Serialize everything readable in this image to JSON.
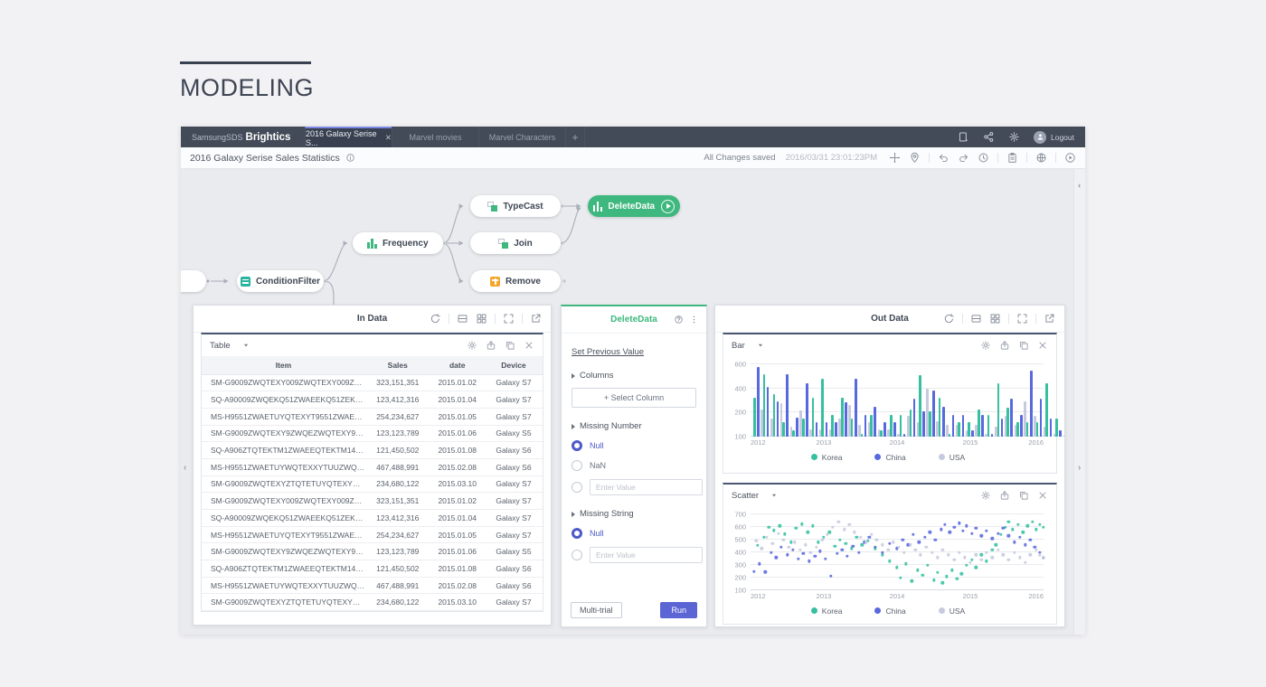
{
  "page": {
    "heading": "MODELING"
  },
  "app": {
    "logo": {
      "brand_light": "SamsungSDS",
      "brand_bold": "Brightics"
    },
    "tabs": [
      {
        "label": "2016 Galaxy Serise S...",
        "active": true,
        "close_label": "✕"
      },
      {
        "label": "Marvel movies",
        "active": false
      },
      {
        "label": "Marvel Characters",
        "active": false
      }
    ],
    "new_tab_label": "+",
    "logout_label": "Logout",
    "toolbar": {
      "title": "2016 Galaxy Serise Sales Statistics",
      "status": "All Changes saved",
      "timestamp": "2016/03/31 23:01:23PM"
    }
  },
  "icons": {
    "gear-icon": "⚙",
    "close-icon": "✕",
    "info-icon": "ⓘ",
    "question-icon": "?",
    "undo-icon": "↶",
    "redo-icon": "↷",
    "clock-icon": "◷",
    "globe-icon": "🌐",
    "play-icon": "▶",
    "pin-icon": "📍",
    "move-icon": "✥",
    "plus-icon": "+",
    "chevron-left-icon": "‹",
    "chevron-right-icon": "›",
    "caret-down-icon": "▾"
  },
  "flow": {
    "nodes": [
      {
        "label": "ConditionFilter"
      },
      {
        "label": "Frequency"
      },
      {
        "label": "TypeCast"
      },
      {
        "label": "Join"
      },
      {
        "label": "Remove"
      },
      {
        "label": "DeleteData"
      }
    ]
  },
  "in_data": {
    "title": "In Data",
    "view_selector": "Table",
    "table": {
      "headers": [
        "Item",
        "Sales",
        "date",
        "Device"
      ],
      "rows": [
        [
          "SM-G9009ZWQTEXY009ZWQTEXY009ZWQSM-G9...",
          "323,151,351",
          "2015.01.02",
          "Galaxy S7"
        ],
        [
          "SQ-A90009ZWQEKQ51ZWAEEKQ51ZEKQ51SQ-A9...",
          "123,412,316",
          "2015.01.04",
          "Galaxy S7"
        ],
        [
          "MS-H9551ZWAETUYQTEXYT9551ZWAETU-H9551...",
          "254,234,627",
          "2015.01.05",
          "Galaxy S7"
        ],
        [
          "SM-G9009ZWQTEXY9ZWQEZWQTEXY9TQ-G9009...",
          "123,123,789",
          "2015.01.06",
          "Galaxy S5"
        ],
        [
          "SQ-A906ZTQTEKTM1ZWAEEQTEKTM144A906ZTQ...",
          "121,450,502",
          "2015.01.08",
          "Galaxy S6"
        ],
        [
          "MS-H9551ZWAETUYWQTEXXYTUUZWQTTMS-H9...",
          "467,488,991",
          "2015.02.08",
          "Galaxy S6"
        ],
        [
          "SM-G9009ZWQTEXYZTQTETUYQTEXYQTESM-G9...",
          "234,680,122",
          "2015.03.10",
          "Galaxy S7"
        ],
        [
          "SM-G9009ZWQTEXY009ZWQTEXY009ZWQSM-G9...",
          "323,151,351",
          "2015.01.02",
          "Galaxy S7"
        ],
        [
          "SQ-A90009ZWQEKQ51ZWAEEKQ51ZEKQ51SQ-A9...",
          "123,412,316",
          "2015.01.04",
          "Galaxy S7"
        ],
        [
          "MS-H9551ZWAETUYQTEXYT9551ZWAETUMS-H95...",
          "254,234,627",
          "2015.01.05",
          "Galaxy S7"
        ],
        [
          "SM-G9009ZWQTEXY9ZWQEZWQTEXY9TQSM-G9...",
          "123,123,789",
          "2015.01.06",
          "Galaxy S5"
        ],
        [
          "SQ-A906ZTQTEKTM1ZWAEEQTEKTM144AA906ZT...",
          "121,450,502",
          "2015.01.08",
          "Galaxy S6"
        ],
        [
          "MS-H9551ZWAETUYWQTEXXYTUUZWQTTA906ZT...",
          "467,488,991",
          "2015.02.08",
          "Galaxy S6"
        ],
        [
          "SM-G9009ZWQTEXYZTQTETUYQTEXYQTEWQTE...",
          "234,680,122",
          "2015.03.10",
          "Galaxy S7"
        ]
      ]
    }
  },
  "delete_data": {
    "title": "DeleteData",
    "set_previous_value": "Set Previous Value",
    "columns_label": "Columns",
    "select_column_button": "+ Select Column",
    "missing_number_label": "Missing Number",
    "number_options": [
      {
        "label": "Null",
        "selected": true
      },
      {
        "label": "NaN",
        "selected": false
      },
      {
        "placeholder": "Enter Value",
        "selected": false
      }
    ],
    "missing_string_label": "Missing String",
    "string_options": [
      {
        "label": "Null",
        "selected": true
      },
      {
        "placeholder": "Enter Value",
        "selected": false
      }
    ],
    "multi_trial_button": "Multi-trial",
    "run_button": "Run"
  },
  "out_data": {
    "title": "Out Data",
    "bar_view_selector": "Bar",
    "scatter_view_selector": "Scatter"
  },
  "chart_data": [
    {
      "type": "bar",
      "title": "Out Data — Bar",
      "x_axis_labels": [
        "2012",
        "2013",
        "2014",
        "2015",
        "2016"
      ],
      "y_ticks": [
        100,
        200,
        400,
        600
      ],
      "legend": [
        "Korea",
        "China",
        "USA"
      ],
      "colors": {
        "Korea": "#36c0a0",
        "China": "#5868de",
        "USA": "#c6cade"
      },
      "series": [
        {
          "name": "Korea",
          "values": [
            320,
            515,
            350,
            160,
            125,
            175,
            320,
            480,
            190,
            320,
            175,
            110,
            190,
            125,
            190,
            190,
            225,
            510,
            210,
            320,
            110,
            160,
            160,
            225,
            190,
            440,
            240,
            160,
            160,
            160,
            445,
            175
          ]
        },
        {
          "name": "China",
          "values": [
            575,
            415,
            290,
            515,
            180,
            445,
            160,
            160,
            160,
            285,
            480,
            190,
            250,
            160,
            160,
            110,
            315,
            210,
            385,
            250,
            190,
            190,
            125,
            190,
            110,
            175,
            315,
            190,
            545,
            315,
            175,
            125
          ]
        },
        {
          "name": "USA",
          "values": [
            225,
            175,
            280,
            140,
            220,
            130,
            130,
            130,
            175,
            260,
            150,
            160,
            130,
            130,
            110,
            185,
            160,
            400,
            165,
            150,
            150,
            125,
            150,
            110,
            140,
            185,
            150,
            290,
            185,
            140,
            110,
            105
          ]
        }
      ]
    },
    {
      "type": "scatter",
      "title": "Out Data — Scatter",
      "x_axis_labels": [
        "2012",
        "2013",
        "2014",
        "2015",
        "2016"
      ],
      "x_range": [
        2012,
        2016
      ],
      "y_ticks": [
        100,
        200,
        300,
        400,
        500,
        600,
        700
      ],
      "legend": [
        "Korea",
        "China",
        "USA"
      ],
      "colors": {
        "Korea": "#36c0a0",
        "China": "#5868de",
        "USA": "#c6cade"
      },
      "series": [
        {
          "name": "Korea",
          "points": [
            [
              2012.1,
              455
            ],
            [
              2012.18,
              520
            ],
            [
              2012.25,
              600
            ],
            [
              2012.32,
              575
            ],
            [
              2012.4,
              610
            ],
            [
              2012.47,
              545
            ],
            [
              2012.55,
              480
            ],
            [
              2012.62,
              590
            ],
            [
              2012.7,
              625
            ],
            [
              2012.78,
              560
            ],
            [
              2012.85,
              610
            ],
            [
              2012.92,
              480
            ],
            [
              2013.0,
              520
            ],
            [
              2013.08,
              560
            ],
            [
              2013.15,
              450
            ],
            [
              2013.22,
              500
            ],
            [
              2013.3,
              470
            ],
            [
              2013.38,
              430
            ],
            [
              2013.45,
              520
            ],
            [
              2013.52,
              460
            ],
            [
              2013.6,
              490
            ],
            [
              2013.7,
              430
            ],
            [
              2013.8,
              380
            ],
            [
              2013.9,
              330
            ],
            [
              2014.0,
              280
            ],
            [
              2014.05,
              200
            ],
            [
              2014.12,
              310
            ],
            [
              2014.2,
              175
            ],
            [
              2014.28,
              260
            ],
            [
              2014.35,
              220
            ],
            [
              2014.42,
              300
            ],
            [
              2014.5,
              180
            ],
            [
              2014.55,
              240
            ],
            [
              2014.62,
              160
            ],
            [
              2014.68,
              210
            ],
            [
              2014.75,
              260
            ],
            [
              2014.82,
              190
            ],
            [
              2014.88,
              230
            ],
            [
              2014.95,
              300
            ],
            [
              2015.02,
              340
            ],
            [
              2015.08,
              280
            ],
            [
              2015.15,
              380
            ],
            [
              2015.22,
              330
            ],
            [
              2015.3,
              420
            ],
            [
              2015.35,
              460
            ],
            [
              2015.42,
              540
            ],
            [
              2015.48,
              600
            ],
            [
              2015.52,
              640
            ],
            [
              2015.58,
              580
            ],
            [
              2015.65,
              620
            ],
            [
              2015.72,
              560
            ],
            [
              2015.78,
              610
            ],
            [
              2015.85,
              640
            ],
            [
              2015.9,
              580
            ],
            [
              2015.95,
              620
            ],
            [
              2016.0,
              600
            ]
          ]
        },
        {
          "name": "China",
          "points": [
            [
              2012.05,
              250
            ],
            [
              2012.12,
              310
            ],
            [
              2012.2,
              245
            ],
            [
              2012.28,
              400
            ],
            [
              2012.35,
              360
            ],
            [
              2012.42,
              440
            ],
            [
              2012.5,
              380
            ],
            [
              2012.58,
              420
            ],
            [
              2012.65,
              350
            ],
            [
              2012.72,
              390
            ],
            [
              2012.8,
              330
            ],
            [
              2012.88,
              370
            ],
            [
              2012.95,
              410
            ],
            [
              2013.02,
              350
            ],
            [
              2013.1,
              215
            ],
            [
              2013.18,
              390
            ],
            [
              2013.25,
              420
            ],
            [
              2013.32,
              370
            ],
            [
              2013.4,
              450
            ],
            [
              2013.48,
              400
            ],
            [
              2013.55,
              480
            ],
            [
              2013.62,
              520
            ],
            [
              2013.7,
              440
            ],
            [
              2013.8,
              400
            ],
            [
              2013.9,
              470
            ],
            [
              2014.0,
              430
            ],
            [
              2014.08,
              500
            ],
            [
              2014.15,
              460
            ],
            [
              2014.22,
              540
            ],
            [
              2014.3,
              480
            ],
            [
              2014.38,
              520
            ],
            [
              2014.45,
              560
            ],
            [
              2014.52,
              500
            ],
            [
              2014.6,
              580
            ],
            [
              2014.65,
              620
            ],
            [
              2014.72,
              560
            ],
            [
              2014.78,
              600
            ],
            [
              2014.85,
              630
            ],
            [
              2014.9,
              570
            ],
            [
              2014.95,
              610
            ],
            [
              2015.02,
              550
            ],
            [
              2015.08,
              590
            ],
            [
              2015.15,
              530
            ],
            [
              2015.22,
              570
            ],
            [
              2015.3,
              510
            ],
            [
              2015.38,
              550
            ],
            [
              2015.45,
              590
            ],
            [
              2015.52,
              530
            ],
            [
              2015.6,
              480
            ],
            [
              2015.68,
              520
            ],
            [
              2015.75,
              460
            ],
            [
              2015.82,
              500
            ],
            [
              2015.88,
              440
            ],
            [
              2015.95,
              400
            ],
            [
              2016.0,
              355
            ]
          ]
        },
        {
          "name": "USA",
          "points": [
            [
              2012.08,
              490
            ],
            [
              2012.15,
              430
            ],
            [
              2012.22,
              520
            ],
            [
              2012.3,
              470
            ],
            [
              2012.38,
              550
            ],
            [
              2012.45,
              500
            ],
            [
              2012.52,
              440
            ],
            [
              2012.6,
              480
            ],
            [
              2012.68,
              420
            ],
            [
              2012.75,
              460
            ],
            [
              2012.82,
              400
            ],
            [
              2012.9,
              440
            ],
            [
              2012.98,
              500
            ],
            [
              2013.05,
              540
            ],
            [
              2013.12,
              600
            ],
            [
              2013.2,
              640
            ],
            [
              2013.28,
              580
            ],
            [
              2013.35,
              620
            ],
            [
              2013.42,
              560
            ],
            [
              2013.5,
              520
            ],
            [
              2013.58,
              480
            ],
            [
              2013.65,
              540
            ],
            [
              2013.72,
              500
            ],
            [
              2013.8,
              460
            ],
            [
              2013.88,
              420
            ],
            [
              2013.95,
              480
            ],
            [
              2014.02,
              440
            ],
            [
              2014.1,
              400
            ],
            [
              2014.18,
              460
            ],
            [
              2014.25,
              420
            ],
            [
              2014.32,
              380
            ],
            [
              2014.4,
              440
            ],
            [
              2014.48,
              400
            ],
            [
              2014.55,
              360
            ],
            [
              2014.62,
              420
            ],
            [
              2014.7,
              380
            ],
            [
              2014.78,
              340
            ],
            [
              2014.85,
              400
            ],
            [
              2014.92,
              360
            ],
            [
              2015.0,
              320
            ],
            [
              2015.08,
              380
            ],
            [
              2015.15,
              340
            ],
            [
              2015.22,
              400
            ],
            [
              2015.3,
              360
            ],
            [
              2015.38,
              420
            ],
            [
              2015.45,
              380
            ],
            [
              2015.52,
              340
            ],
            [
              2015.6,
              400
            ],
            [
              2015.68,
              360
            ],
            [
              2015.75,
              320
            ],
            [
              2015.82,
              380
            ],
            [
              2015.9,
              420
            ],
            [
              2015.95,
              380
            ],
            [
              2016.0,
              360
            ]
          ]
        }
      ]
    }
  ]
}
